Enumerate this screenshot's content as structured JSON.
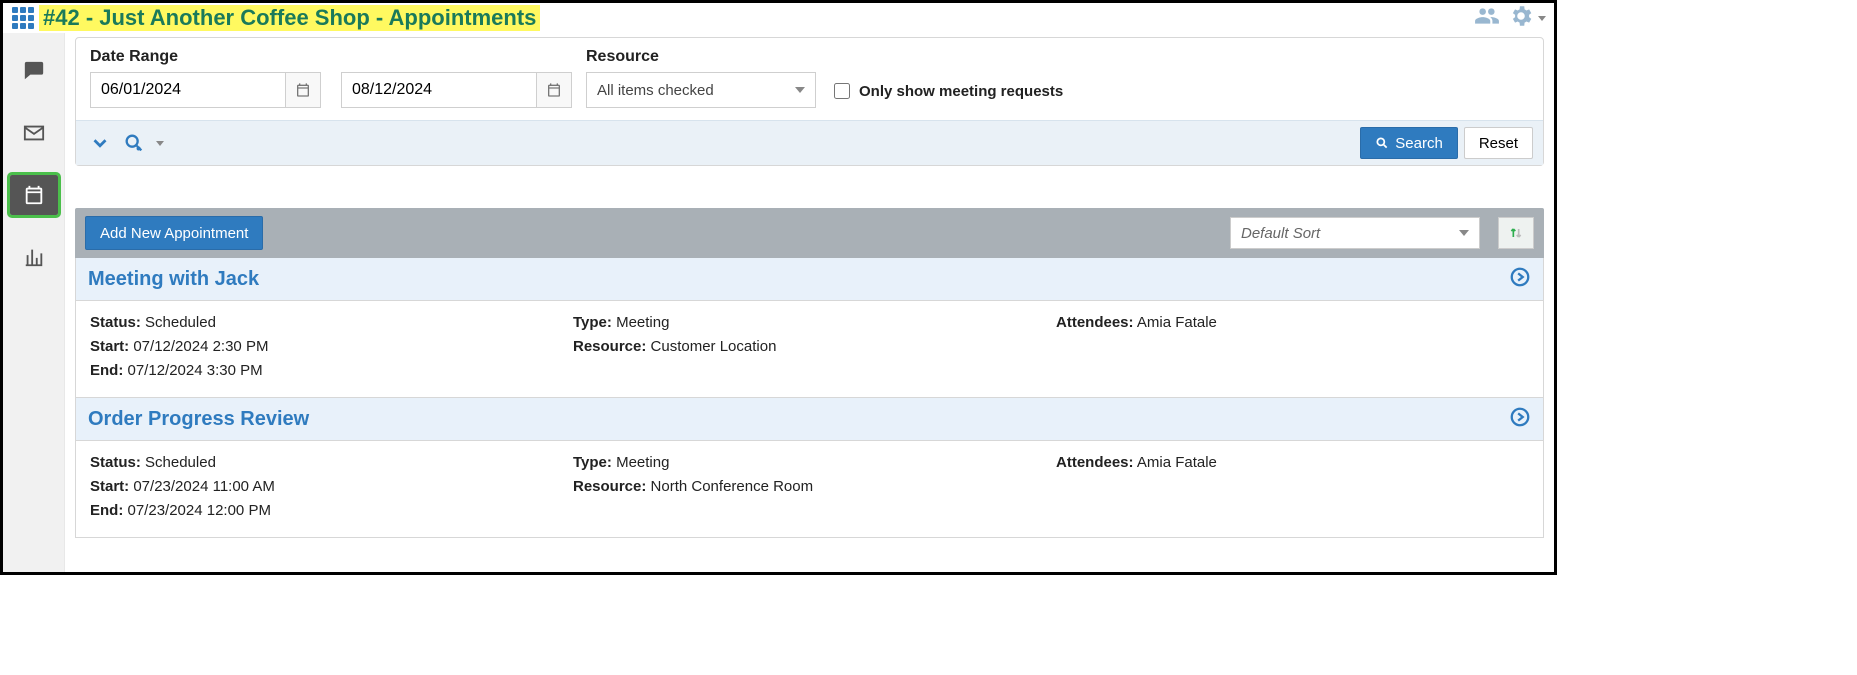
{
  "header": {
    "title": "#42 - Just Another Coffee Shop - Appointments"
  },
  "filters": {
    "date_label": "Date Range",
    "date_from": "06/01/2024",
    "date_to": "08/12/2024",
    "resource_label": "Resource",
    "resource_value": "All items checked",
    "only_meetings_label": "Only show meeting requests",
    "search_label": "Search",
    "reset_label": "Reset"
  },
  "toolbar": {
    "add_label": "Add New Appointment",
    "sort_value": "Default Sort"
  },
  "appointments": [
    {
      "title": "Meeting with Jack",
      "status": "Scheduled",
      "start": "07/12/2024 2:30 PM",
      "end": "07/12/2024 3:30 PM",
      "type": "Meeting",
      "resource": "Customer Location",
      "attendees": "Amia Fatale"
    },
    {
      "title": "Order Progress Review",
      "status": "Scheduled",
      "start": "07/23/2024 11:00 AM",
      "end": "07/23/2024 12:00 PM",
      "type": "Meeting",
      "resource": "North Conference Room",
      "attendees": "Amia Fatale"
    }
  ],
  "labels": {
    "status": "Status:",
    "start": "Start:",
    "end": "End:",
    "type": "Type:",
    "resource": "Resource:",
    "attendees": "Attendees:"
  }
}
